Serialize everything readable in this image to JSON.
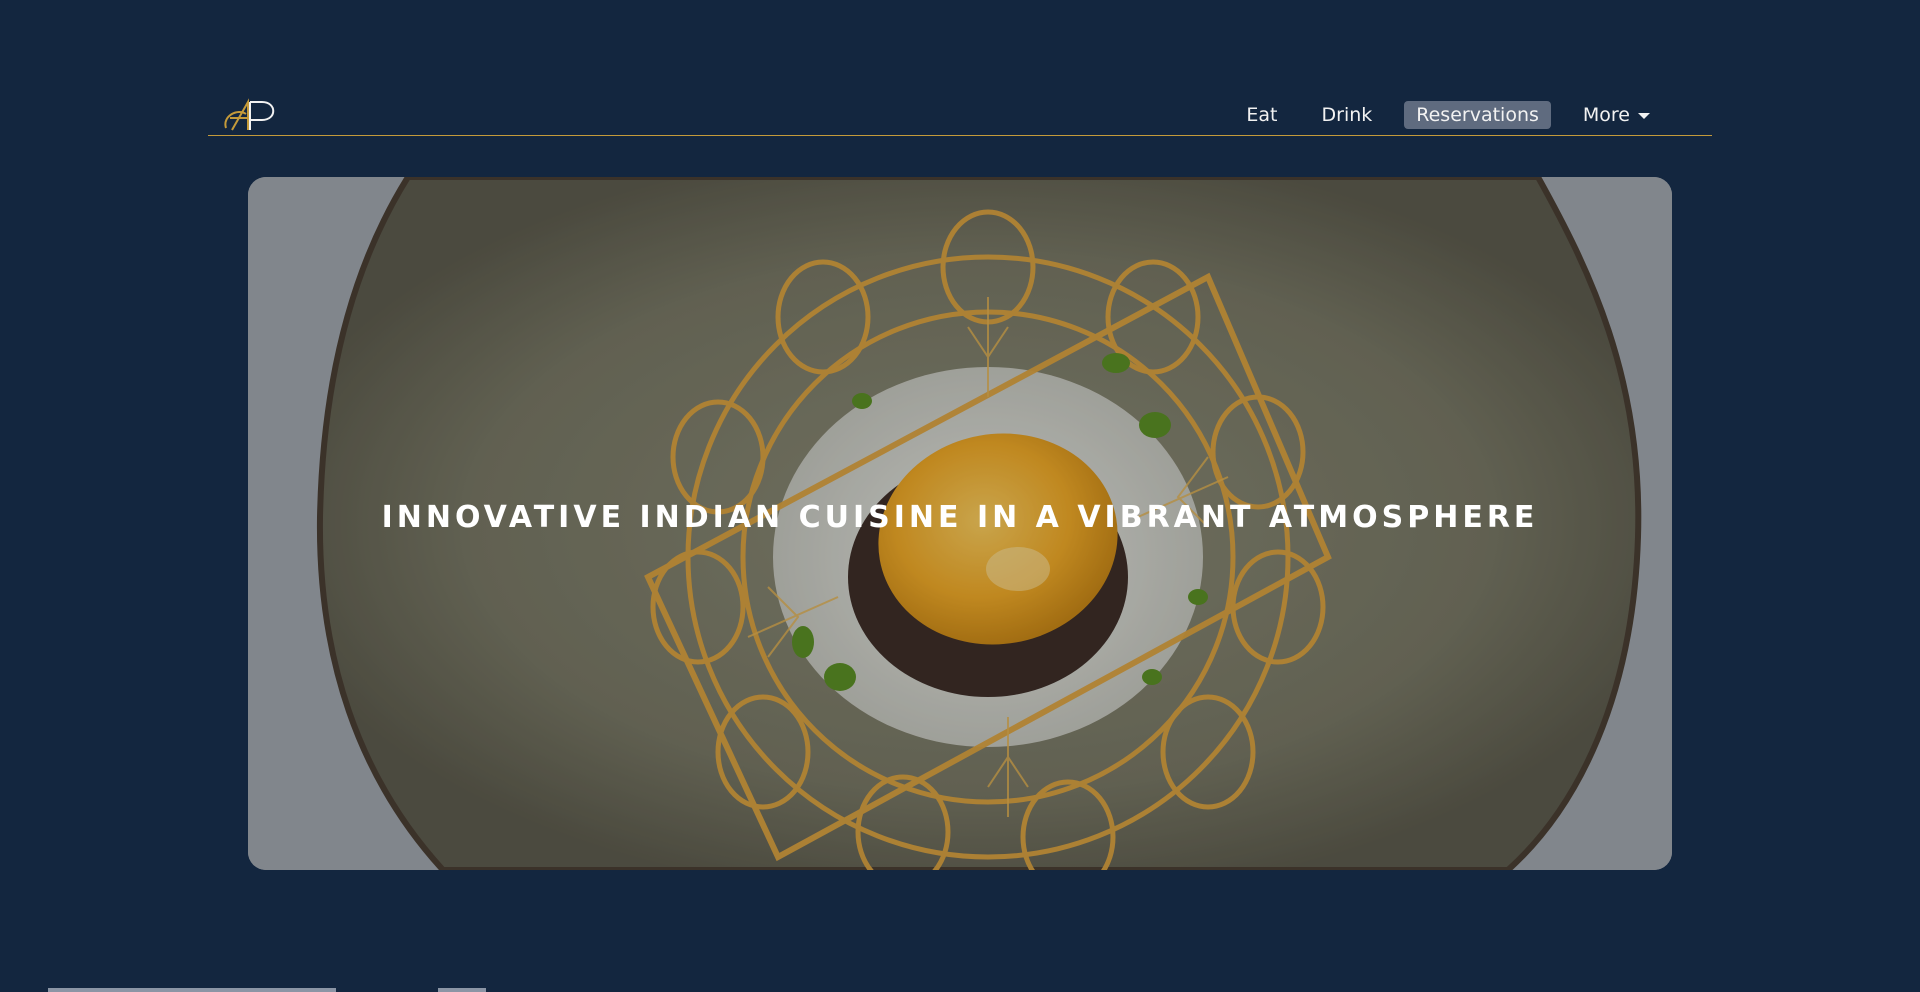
{
  "nav": {
    "links": [
      {
        "label": "Eat"
      },
      {
        "label": "Drink"
      },
      {
        "label": "Reservations"
      },
      {
        "label": "More"
      }
    ]
  },
  "hero": {
    "title": "INNOVATIVE INDIAN CUISINE IN A VIBRANT ATMOSPHERE"
  },
  "colors": {
    "background": "#13263f",
    "accent": "#c49a3a",
    "active_nav": "#5f6b7f"
  },
  "icons": {
    "logo": "ap-monogram-logo",
    "more": "caret-down-icon"
  }
}
